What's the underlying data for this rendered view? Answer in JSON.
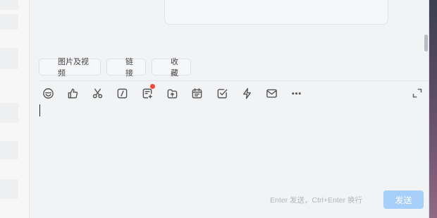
{
  "quick_actions": [
    {
      "label": "图片及视频"
    },
    {
      "label": "链接"
    },
    {
      "label": "收藏"
    }
  ],
  "toolbar": {
    "icons": [
      "emoji-icon",
      "thumbs-up-icon",
      "scissors-icon",
      "slash-command-icon",
      "doc-add-icon",
      "upload-folder-icon",
      "calendar-icon",
      "task-check-icon",
      "lightning-icon",
      "mail-icon",
      "more-icon"
    ],
    "doc_add_has_badge": true
  },
  "composer": {
    "hint": "Enter 发送，Ctrl+Enter 换行",
    "send_label": "发送"
  },
  "colors": {
    "send_button_disabled": "#a6cffa",
    "badge": "#f04a3a",
    "background": "#f2f3f5"
  }
}
